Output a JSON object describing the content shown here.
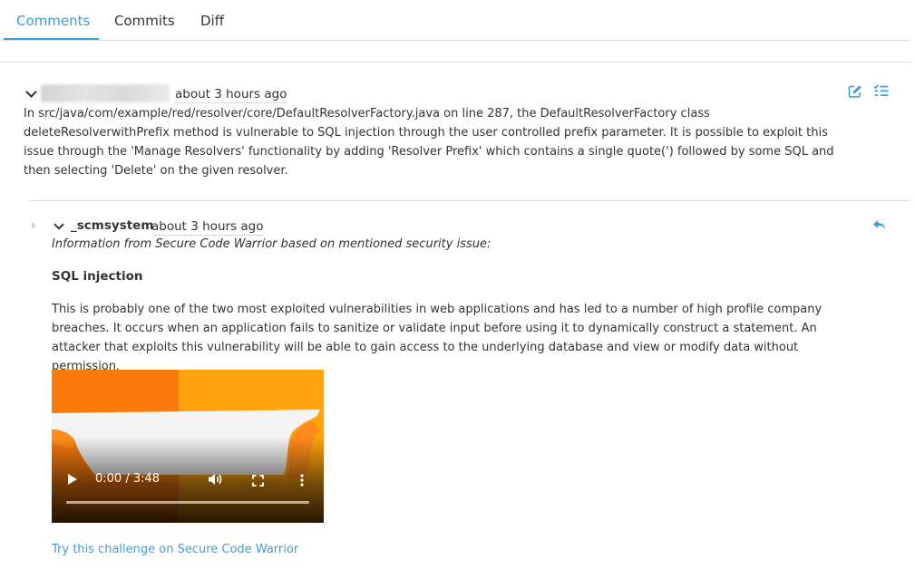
{
  "tabs": [
    {
      "label": "Comments",
      "active": true
    },
    {
      "label": "Commits",
      "active": false
    },
    {
      "label": "Diff",
      "active": false
    }
  ],
  "comment": {
    "timestamp": "about 3 hours ago",
    "body": "In src/java/com/example/red/resolver/core/DefaultResolverFactory.java on line 287, the DefaultResolverFactory class deleteResolverwithPrefix method is vulnerable to SQL injection through the user controlled prefix parameter. It is possible to exploit this issue through the 'Manage Resolvers' functionality by adding 'Resolver Prefix' which contains a single quote(') followed by some SQL and then selecting 'Delete' on the given resolver."
  },
  "reply": {
    "author": "_scmsystem",
    "timestamp": "about 3 hours ago",
    "intro": "Information from Secure Code Warrior based on mentioned security issue:",
    "title": "SQL injection",
    "description": "This is probably one of the two most exploited vulnerabilities in web applications and has led to a number of high profile company breaches. It occurs when an application fails to sanitize or validate input before using it to dynamically construct a statement. An attacker that exploits this vulnerability will be able to gain access to the underlying database and view or modify data without permission.",
    "video": {
      "time": "0:00 / 3:48",
      "progress": 0
    },
    "link_label": "Try this challenge on Secure Code Warrior"
  },
  "icons": {
    "edit": "edit-icon",
    "tasklist": "tasklist-icon",
    "reply": "reply-icon",
    "collapse": "chevron-down-icon",
    "expand": "caret-right-icon",
    "play": "play-icon",
    "volume": "volume-icon",
    "fullscreen": "fullscreen-icon",
    "more": "more-vertical-icon"
  },
  "colors": {
    "accent": "#3a9fd6",
    "text": "#333333",
    "border": "#dddddd",
    "video_orange": "#ff9a10"
  }
}
